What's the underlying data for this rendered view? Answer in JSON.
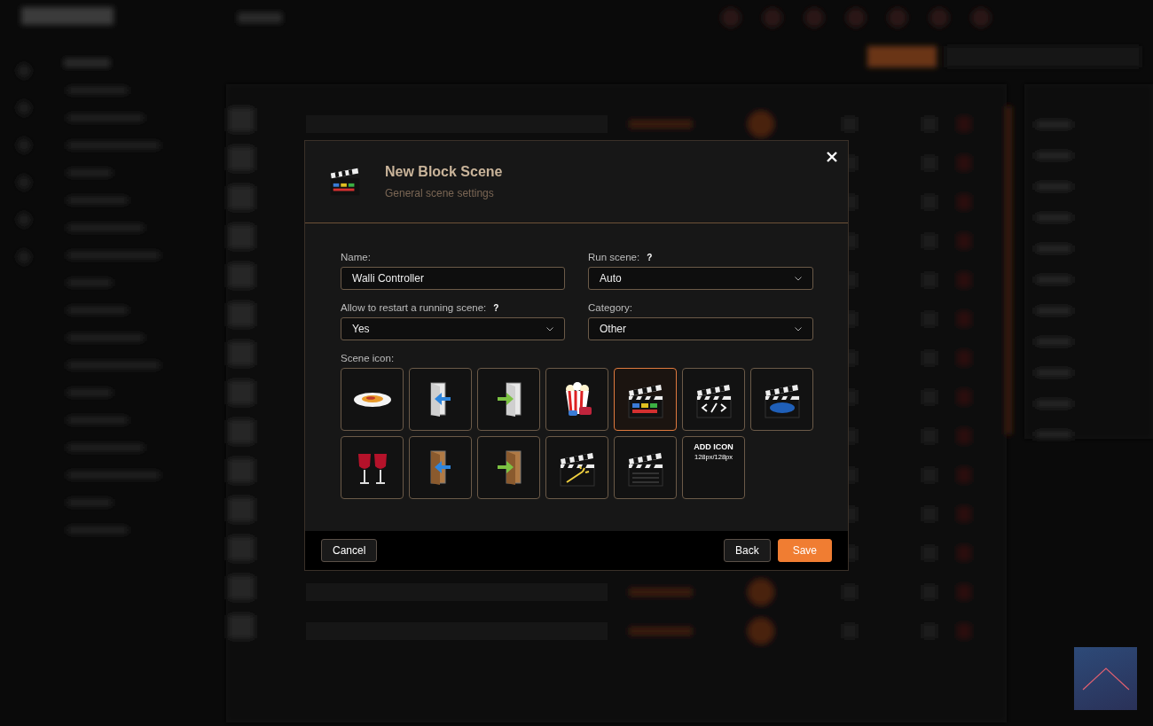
{
  "dialog": {
    "title": "New Block Scene",
    "subtitle": "General scene settings",
    "fields": [
      {
        "kind": "text",
        "label": "Name:",
        "value": "Walli Controller"
      },
      {
        "kind": "select",
        "label": "Run scene:",
        "help": "?",
        "value": "Auto"
      },
      {
        "kind": "select",
        "label": "Allow to restart a running scene:",
        "help": "?",
        "value": "Yes"
      },
      {
        "kind": "select",
        "label": "Category:",
        "value": "Other"
      }
    ],
    "icon_label": "Scene icon:",
    "icons": [
      {
        "kind": "plate",
        "selected": false
      },
      {
        "kind": "door-blue",
        "selected": false
      },
      {
        "kind": "door-green",
        "selected": false
      },
      {
        "kind": "popcorn",
        "selected": false
      },
      {
        "kind": "clapper-color",
        "selected": true
      },
      {
        "kind": "clapper-code",
        "selected": false
      },
      {
        "kind": "clapper-blue",
        "selected": false
      },
      {
        "kind": "wine",
        "selected": false
      },
      {
        "kind": "wood-door-blue",
        "selected": false
      },
      {
        "kind": "wood-door-green",
        "selected": false
      },
      {
        "kind": "clapper-magic",
        "selected": false
      },
      {
        "kind": "clapper-plain",
        "selected": false
      }
    ],
    "add_icon": {
      "title": "ADD ICON",
      "size": "128px/128px"
    },
    "buttons": {
      "cancel": "Cancel",
      "back": "Back",
      "save": "Save"
    }
  }
}
